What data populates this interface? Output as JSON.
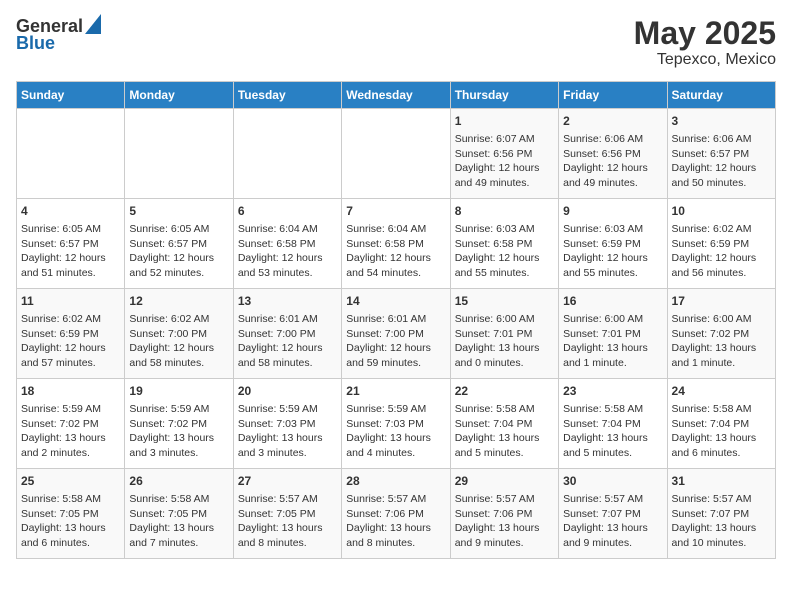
{
  "header": {
    "logo_general": "General",
    "logo_blue": "Blue",
    "title": "May 2025",
    "subtitle": "Tepexco, Mexico"
  },
  "weekdays": [
    "Sunday",
    "Monday",
    "Tuesday",
    "Wednesday",
    "Thursday",
    "Friday",
    "Saturday"
  ],
  "weeks": [
    [
      {
        "day": "",
        "info": ""
      },
      {
        "day": "",
        "info": ""
      },
      {
        "day": "",
        "info": ""
      },
      {
        "day": "",
        "info": ""
      },
      {
        "day": "1",
        "info": "Sunrise: 6:07 AM\nSunset: 6:56 PM\nDaylight: 12 hours\nand 49 minutes."
      },
      {
        "day": "2",
        "info": "Sunrise: 6:06 AM\nSunset: 6:56 PM\nDaylight: 12 hours\nand 49 minutes."
      },
      {
        "day": "3",
        "info": "Sunrise: 6:06 AM\nSunset: 6:57 PM\nDaylight: 12 hours\nand 50 minutes."
      }
    ],
    [
      {
        "day": "4",
        "info": "Sunrise: 6:05 AM\nSunset: 6:57 PM\nDaylight: 12 hours\nand 51 minutes."
      },
      {
        "day": "5",
        "info": "Sunrise: 6:05 AM\nSunset: 6:57 PM\nDaylight: 12 hours\nand 52 minutes."
      },
      {
        "day": "6",
        "info": "Sunrise: 6:04 AM\nSunset: 6:58 PM\nDaylight: 12 hours\nand 53 minutes."
      },
      {
        "day": "7",
        "info": "Sunrise: 6:04 AM\nSunset: 6:58 PM\nDaylight: 12 hours\nand 54 minutes."
      },
      {
        "day": "8",
        "info": "Sunrise: 6:03 AM\nSunset: 6:58 PM\nDaylight: 12 hours\nand 55 minutes."
      },
      {
        "day": "9",
        "info": "Sunrise: 6:03 AM\nSunset: 6:59 PM\nDaylight: 12 hours\nand 55 minutes."
      },
      {
        "day": "10",
        "info": "Sunrise: 6:02 AM\nSunset: 6:59 PM\nDaylight: 12 hours\nand 56 minutes."
      }
    ],
    [
      {
        "day": "11",
        "info": "Sunrise: 6:02 AM\nSunset: 6:59 PM\nDaylight: 12 hours\nand 57 minutes."
      },
      {
        "day": "12",
        "info": "Sunrise: 6:02 AM\nSunset: 7:00 PM\nDaylight: 12 hours\nand 58 minutes."
      },
      {
        "day": "13",
        "info": "Sunrise: 6:01 AM\nSunset: 7:00 PM\nDaylight: 12 hours\nand 58 minutes."
      },
      {
        "day": "14",
        "info": "Sunrise: 6:01 AM\nSunset: 7:00 PM\nDaylight: 12 hours\nand 59 minutes."
      },
      {
        "day": "15",
        "info": "Sunrise: 6:00 AM\nSunset: 7:01 PM\nDaylight: 13 hours\nand 0 minutes."
      },
      {
        "day": "16",
        "info": "Sunrise: 6:00 AM\nSunset: 7:01 PM\nDaylight: 13 hours\nand 1 minute."
      },
      {
        "day": "17",
        "info": "Sunrise: 6:00 AM\nSunset: 7:02 PM\nDaylight: 13 hours\nand 1 minute."
      }
    ],
    [
      {
        "day": "18",
        "info": "Sunrise: 5:59 AM\nSunset: 7:02 PM\nDaylight: 13 hours\nand 2 minutes."
      },
      {
        "day": "19",
        "info": "Sunrise: 5:59 AM\nSunset: 7:02 PM\nDaylight: 13 hours\nand 3 minutes."
      },
      {
        "day": "20",
        "info": "Sunrise: 5:59 AM\nSunset: 7:03 PM\nDaylight: 13 hours\nand 3 minutes."
      },
      {
        "day": "21",
        "info": "Sunrise: 5:59 AM\nSunset: 7:03 PM\nDaylight: 13 hours\nand 4 minutes."
      },
      {
        "day": "22",
        "info": "Sunrise: 5:58 AM\nSunset: 7:04 PM\nDaylight: 13 hours\nand 5 minutes."
      },
      {
        "day": "23",
        "info": "Sunrise: 5:58 AM\nSunset: 7:04 PM\nDaylight: 13 hours\nand 5 minutes."
      },
      {
        "day": "24",
        "info": "Sunrise: 5:58 AM\nSunset: 7:04 PM\nDaylight: 13 hours\nand 6 minutes."
      }
    ],
    [
      {
        "day": "25",
        "info": "Sunrise: 5:58 AM\nSunset: 7:05 PM\nDaylight: 13 hours\nand 6 minutes."
      },
      {
        "day": "26",
        "info": "Sunrise: 5:58 AM\nSunset: 7:05 PM\nDaylight: 13 hours\nand 7 minutes."
      },
      {
        "day": "27",
        "info": "Sunrise: 5:57 AM\nSunset: 7:05 PM\nDaylight: 13 hours\nand 8 minutes."
      },
      {
        "day": "28",
        "info": "Sunrise: 5:57 AM\nSunset: 7:06 PM\nDaylight: 13 hours\nand 8 minutes."
      },
      {
        "day": "29",
        "info": "Sunrise: 5:57 AM\nSunset: 7:06 PM\nDaylight: 13 hours\nand 9 minutes."
      },
      {
        "day": "30",
        "info": "Sunrise: 5:57 AM\nSunset: 7:07 PM\nDaylight: 13 hours\nand 9 minutes."
      },
      {
        "day": "31",
        "info": "Sunrise: 5:57 AM\nSunset: 7:07 PM\nDaylight: 13 hours\nand 10 minutes."
      }
    ]
  ]
}
